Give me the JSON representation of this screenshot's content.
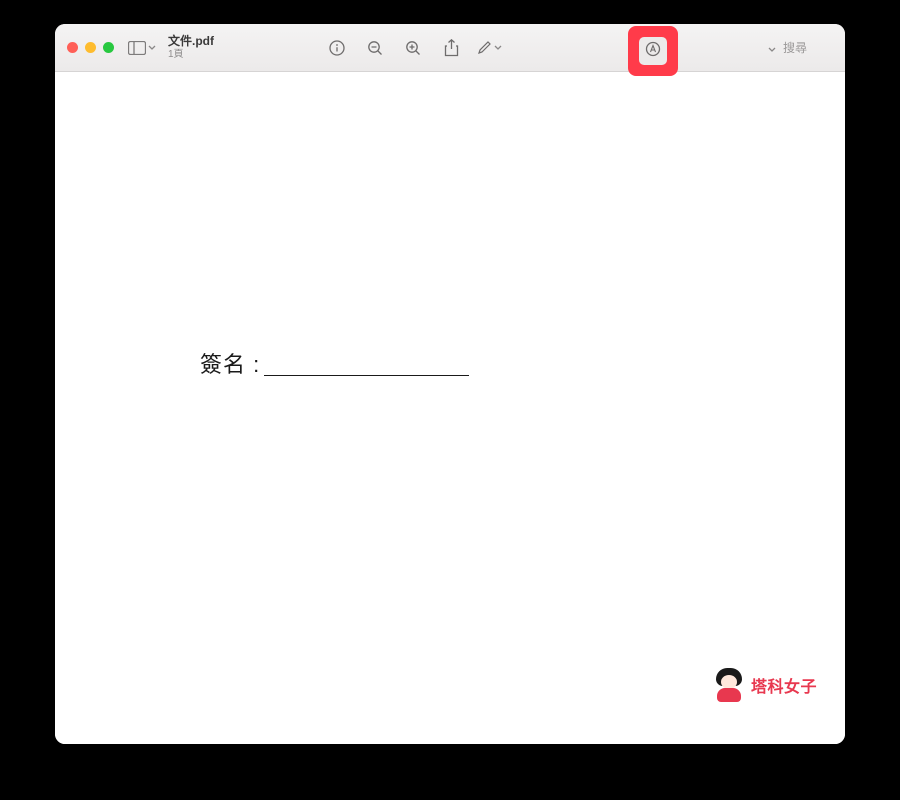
{
  "window": {
    "title": "文件.pdf",
    "subtitle": "1頁"
  },
  "toolbar": {
    "search_placeholder": "搜尋"
  },
  "document": {
    "signature_label": "簽名 :"
  },
  "watermark": {
    "text": "塔科女子"
  },
  "icons": {
    "sidebar": "sidebar-icon",
    "info": "info-icon",
    "zoom_out": "zoom-out-icon",
    "zoom_in": "zoom-in-icon",
    "share": "share-icon",
    "annotate": "pencil-icon",
    "markup": "markup-toolbar-icon",
    "search_chevron": "chevron-down-icon"
  }
}
